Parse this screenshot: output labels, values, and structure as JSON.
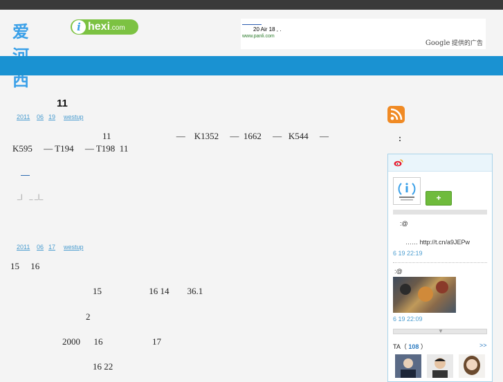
{
  "site": {
    "logo_cn": "爱河西",
    "logo_i": "i",
    "logo_en": "hexi",
    "logo_domain": ".com"
  },
  "ad": {
    "text": "20    Air    18 ,        .",
    "url": "www.panli.com",
    "provider_brand": "Google",
    "provider_text": "提供的广告"
  },
  "posts": [
    {
      "title": "11",
      "meta": [
        "2011",
        "06",
        "19",
        "westup"
      ],
      "lines": [
        "11                             —    K1352     —  1662     —   K544     —",
        "K595     — T194     — T198  11"
      ],
      "footer": "_|    _ _|_"
    },
    {
      "meta": [
        "2011",
        "06",
        "17",
        "westup"
      ],
      "lines": [
        "15     16",
        "15                     16 14        36.1",
        "2",
        "2000      16                      17",
        "16 22"
      ]
    }
  ],
  "sidebar": {
    "colon": ":",
    "follow_label": "+",
    "weibo_items": [
      {
        "line1": ":@",
        "line2": "…… http://t.cn/a9JEPw",
        "time": "6 19  22:19"
      },
      {
        "line1": ":@",
        "time": "6 19  22:09"
      }
    ],
    "fans_label": "TA",
    "fans_count": "108",
    "more_label": ">>"
  },
  "colors": {
    "topbar": "#3a3a3a",
    "navbar": "#1a92d2",
    "link": "#4a9ccf",
    "follow_green": "#6fbb3c",
    "rss_orange": "#f08a24"
  }
}
